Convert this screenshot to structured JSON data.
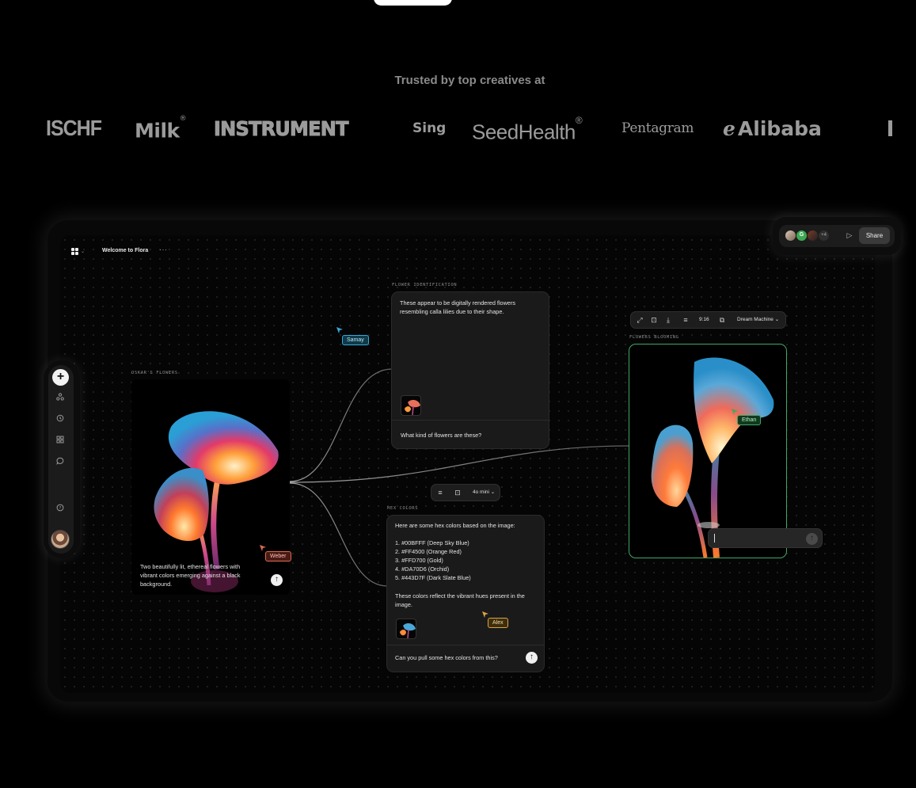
{
  "trusted_heading": "Trusted by top creatives at",
  "logos": {
    "ischf": "ISCHF",
    "milk": "Milk",
    "milk_mark": "®",
    "instrument": "INSTRUMENT",
    "sing": "Sing",
    "seedhealth": "SeedHealth",
    "seedhealth_mark": "®",
    "pentagram": "Pentagram",
    "alibaba": "Alibaba",
    "alibaba_mark": "e"
  },
  "app": {
    "title": "Welcome to Flora",
    "more": "···",
    "logo_icon": "flora-grid-icon"
  },
  "collab": {
    "avatar_g": "G",
    "extra_count": "+4",
    "share_label": "Share"
  },
  "sidebar": {
    "add": "+",
    "icons": [
      "nodes-icon",
      "history-icon",
      "apps-icon",
      "comment-icon",
      "help-icon"
    ]
  },
  "nodes": {
    "oskar": {
      "label": "OSKAR'S FLOWERS",
      "caption": "Two beautifully lit, ethereal flowers with vibrant colors emerging against a black background."
    },
    "identification": {
      "label": "FLOWER IDENTIFICATION",
      "response": "These appear to be digitally rendered flowers resembling calla lilies due to their shape.",
      "prompt": "What kind of flowers are these?"
    },
    "hex": {
      "label": "HEX COLORS",
      "intro": "Here are some hex colors based on the image:",
      "colors": [
        "1. #00BFFF (Deep Sky Blue)",
        "2. #FF4500 (Orange Red)",
        "3. #FFD700 (Gold)",
        "4. #DA70D6 (Orchid)",
        "5. #443D7F (Dark Slate Blue)"
      ],
      "outro": "These colors reflect the vibrant hues present in the image.",
      "prompt": "Can you pull some hex colors from this?"
    },
    "blooming": {
      "label": "FLOWERS BLOOMING"
    }
  },
  "model_toolbar": {
    "model": "4o mini"
  },
  "video_toolbar": {
    "ratio": "9:16",
    "model": "Dream Machine"
  },
  "cursors": {
    "samay": {
      "name": "Samay",
      "color": "#3aa7d6"
    },
    "weber": {
      "name": "Weber",
      "color": "#e06a52"
    },
    "alex": {
      "name": "Alex",
      "color": "#d9a441"
    },
    "ethan": {
      "name": "Ethan",
      "color": "#3fa866"
    }
  },
  "colors": {
    "accent_green": "#3fa866",
    "background": "#000000"
  }
}
